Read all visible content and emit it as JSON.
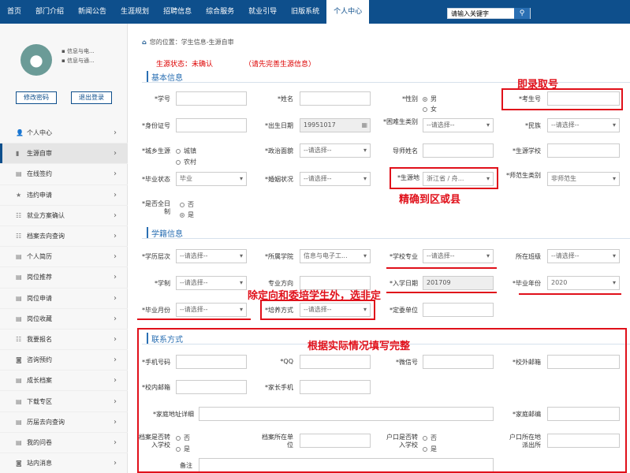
{
  "nav": {
    "items": [
      "首页",
      "部门介绍",
      "新闻公告",
      "生涯规划",
      "招聘信息",
      "综合服务",
      "就业引导",
      "旧版系统",
      "个人中心"
    ],
    "active_index": 8,
    "search_placeholder": "请输入关键字"
  },
  "sidebar": {
    "user_line1": "信息与电...",
    "user_line2": "信息与通...",
    "btn_change_password": "修改密码",
    "btn_logout": "退出登录",
    "items": [
      {
        "label": "个人中心",
        "icon": "user-icon"
      },
      {
        "label": "生源自审",
        "icon": "bar-icon",
        "active": true
      },
      {
        "label": "在线签约",
        "icon": "doc-icon"
      },
      {
        "label": "违约申请",
        "icon": "star-icon"
      },
      {
        "label": "就业方案确认",
        "icon": "list-icon"
      },
      {
        "label": "档案去向查询",
        "icon": "list-icon"
      },
      {
        "label": "个人简历",
        "icon": "doc-icon"
      },
      {
        "label": "岗位推荐",
        "icon": "doc-icon"
      },
      {
        "label": "岗位申请",
        "icon": "doc-icon"
      },
      {
        "label": "岗位收藏",
        "icon": "doc-icon"
      },
      {
        "label": "我要报名",
        "icon": "list-icon"
      },
      {
        "label": "咨询预约",
        "icon": "chat-icon"
      },
      {
        "label": "成长档案",
        "icon": "doc-icon"
      },
      {
        "label": "下载专区",
        "icon": "doc-icon"
      },
      {
        "label": "历届去向查询",
        "icon": "doc-icon"
      },
      {
        "label": "我的问卷",
        "icon": "doc-icon"
      },
      {
        "label": "站内消息",
        "icon": "chat-icon"
      }
    ]
  },
  "breadcrumb": "您的位置：学生信息-生源自审",
  "status": {
    "label": "生源状态：未确认",
    "hint": "（请先完善生源信息）"
  },
  "sections": {
    "basic": "基本信息",
    "school": "学籍信息",
    "contact": "联系方式"
  },
  "labels": {
    "student_no": "*学号",
    "name": "*姓名",
    "gender": "*性别",
    "exam_no": "*考生号",
    "id_no": "*身份证号",
    "birth": "*出生日期",
    "poverty": "*困难生类别",
    "ethnic": "*民族",
    "origin_type": "*城乡生源",
    "politics": "*政治面貌",
    "tutor": "导师姓名",
    "origin_school": "*生源学校",
    "grad_status": "*毕业状态",
    "marriage": "*婚姻状况",
    "origin_place": "*生源地",
    "normal_type": "*师范生类别",
    "full_time": "*是否全日制",
    "degree_level": "*学历层次",
    "college": "*所属学院",
    "major": "*学校专业",
    "class": "所在班级",
    "duration": "*学制",
    "direction": "专业方向",
    "entry_date": "*入学日期",
    "grad_year": "*毕业年份",
    "grad_month": "*毕业月份",
    "train_mode": "*培养方式",
    "target_unit": "*定委单位",
    "mobile": "*手机号码",
    "qq": "*QQ",
    "wechat": "*微信号",
    "ext_email": "*校外邮箱",
    "campus_email": "*校内邮箱",
    "parent_phone": "*家长手机",
    "home_address": "*家庭地址详细",
    "home_post": "*家庭邮编",
    "archive_transfer": "档案是否转入学校",
    "archive_place": "档案所在单位",
    "hukou_transfer": "户口是否转入学校",
    "hukou_police": "户口所在地派出所",
    "remark": "备注"
  },
  "values": {
    "gender_options": [
      "男",
      "女"
    ],
    "origin_type_options": [
      "城镇",
      "农村"
    ],
    "full_time_options": [
      "否",
      "是"
    ],
    "yes_no": [
      "否",
      "是"
    ],
    "birth": "19951017",
    "placeholder": "--请选择--",
    "grad_status": "毕业",
    "origin_place": "浙江省 / 舟...",
    "normal_type": "非师范生",
    "college": "信息与电子工...",
    "entry_date": "201709",
    "grad_year": "2020"
  },
  "annotations": {
    "exam": "即录取号",
    "origin": "精确到区或县",
    "train": "除定向和委培学生外，选非定",
    "contact": "根据实际情况填写完整"
  }
}
